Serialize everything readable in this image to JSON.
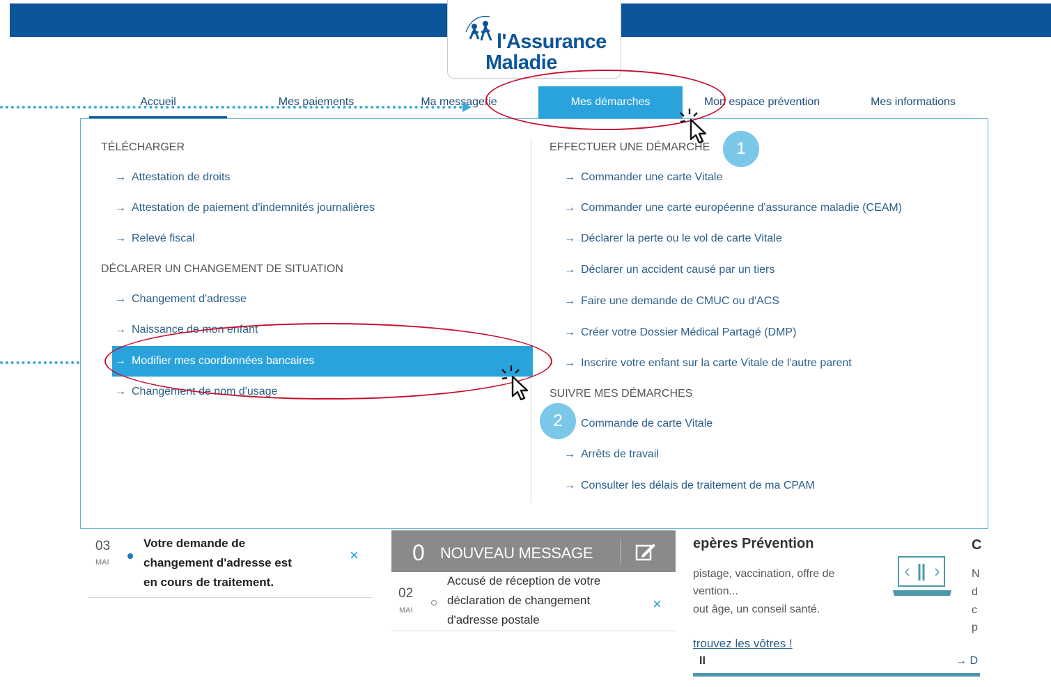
{
  "header": {
    "logo_line1": "l'Assurance",
    "logo_line2": "Maladie"
  },
  "nav": [
    {
      "label": "Accueil"
    },
    {
      "label": "Mes paiements"
    },
    {
      "label": "Ma messagerie"
    },
    {
      "label": "Mes démarches",
      "active": true
    },
    {
      "label": "Mon espace prévention"
    },
    {
      "label": "Mes informations"
    }
  ],
  "menu": {
    "left": {
      "section1": "TÉLÉCHARGER",
      "s1_items": [
        "Attestation de droits",
        "Attestation de paiement d'indemnités journalières",
        "Relevé fiscal"
      ],
      "section2": "DÉCLARER UN CHANGEMENT DE SITUATION",
      "s2_items": [
        "Changement d'adresse",
        "Naissance de mon enfant",
        "Modifier mes coordonnées bancaires",
        "Changement de nom d'usage"
      ]
    },
    "right": {
      "section1": "EFFECTUER UNE DÉMARCHE",
      "s1_items": [
        "Commander une carte Vitale",
        "Commander une carte européenne d'assurance maladie (CEAM)",
        "Déclarer la perte ou le vol de carte Vitale",
        "Déclarer un accident causé par un tiers",
        "Faire une demande de CMUC ou d'ACS",
        "Créer votre Dossier Médical Partagé (DMP)",
        "Inscrire votre enfant sur la carte Vitale de l'autre parent"
      ],
      "section2": "SUIVRE MES DÉMARCHES",
      "s2_items": [
        "Commande de carte Vitale",
        "Arrêts de travail",
        "Consulter les délais de traitement de ma CPAM"
      ]
    }
  },
  "arrow_glyph": "→",
  "annotations": {
    "badge1": "1",
    "badge2": "2"
  },
  "notification": {
    "day": "03",
    "month": "MAI",
    "lines": [
      "Votre demande de",
      "changement d'adresse est",
      "en cours de traitement."
    ],
    "close": "×"
  },
  "messages": {
    "count": "0",
    "label": "NOUVEAU MESSAGE",
    "day": "02",
    "month": "MAI",
    "lines": [
      "Accusé de réception de votre",
      "déclaration de changement",
      "d'adresse postale"
    ],
    "close": "×"
  },
  "prevention": {
    "title": "epères Prévention",
    "lines": [
      "pistage, vaccination, offre de",
      "vention...",
      "out âge, un conseil santé."
    ],
    "link": "trouvez les vôtres !",
    "pause": "II",
    "more": "→ D",
    "clip_letters": [
      "C",
      "N",
      "d",
      "c",
      "p"
    ]
  },
  "colors": {
    "brand_blue": "#0c559a",
    "accent": "#2aa3dc",
    "annotation_red": "#c8102e"
  }
}
